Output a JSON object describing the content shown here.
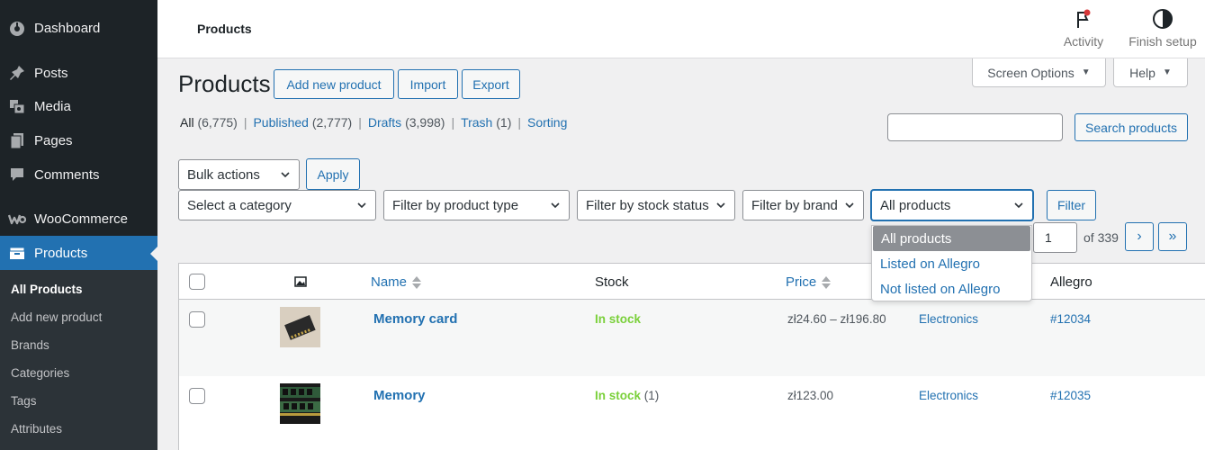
{
  "sidebar": {
    "menu": [
      {
        "label": "Dashboard",
        "icon": "dashboard-icon"
      },
      {
        "label": "Posts",
        "icon": "pin-icon"
      },
      {
        "label": "Media",
        "icon": "media-icon"
      },
      {
        "label": "Pages",
        "icon": "pages-icon"
      },
      {
        "label": "Comments",
        "icon": "comments-icon"
      },
      {
        "label": "WooCommerce",
        "icon": "woocommerce-icon"
      },
      {
        "label": "Products",
        "icon": "products-icon"
      }
    ],
    "submenu": [
      "All Products",
      "Add new product",
      "Brands",
      "Categories",
      "Tags",
      "Attributes"
    ]
  },
  "topbar": {
    "breadcrumb": "Products",
    "activity_label": "Activity",
    "finish_setup_label": "Finish setup"
  },
  "screen_options_label": "Screen Options",
  "help_label": "Help",
  "page": {
    "title": "Products",
    "add_new_label": "Add new product",
    "import_label": "Import",
    "export_label": "Export"
  },
  "views": [
    {
      "label": "All",
      "count": "(6,775)"
    },
    {
      "label": "Published",
      "count": "(2,777)"
    },
    {
      "label": "Drafts",
      "count": "(3,998)"
    },
    {
      "label": "Trash",
      "count": "(1)"
    },
    {
      "label": "Sorting",
      "count": ""
    }
  ],
  "search": {
    "value": "",
    "button_label": "Search products"
  },
  "bulk": {
    "selected": "Bulk actions",
    "apply_label": "Apply"
  },
  "filters": {
    "category": "Select a category",
    "product_type": "Filter by product type",
    "stock_status": "Filter by stock status",
    "brand": "Filter by brand",
    "allegro": "All products",
    "allegro_options": [
      "All products",
      "Listed on Allegro",
      "Not listed on Allegro"
    ],
    "filter_button_label": "Filter"
  },
  "pagination": {
    "current": "1",
    "of_text": "of 339",
    "next": "›",
    "last": "»"
  },
  "table": {
    "headers": {
      "name": "Name",
      "stock": "Stock",
      "price": "Price",
      "allegro": "Allegro"
    },
    "rows": [
      {
        "name": "Memory card",
        "stock": "In stock",
        "stock_qty": "",
        "price": "zł24.60 – zł196.80",
        "category": "Electronics",
        "allegro": "#12034"
      },
      {
        "name": "Memory",
        "stock": "In stock",
        "stock_qty": "(1)",
        "price": "zł123.00",
        "category": "Electronics",
        "allegro": "#12035"
      }
    ]
  },
  "colors": {
    "accent": "#2271b1",
    "sidebar": "#1d2327",
    "in_stock": "#7ad03a"
  }
}
